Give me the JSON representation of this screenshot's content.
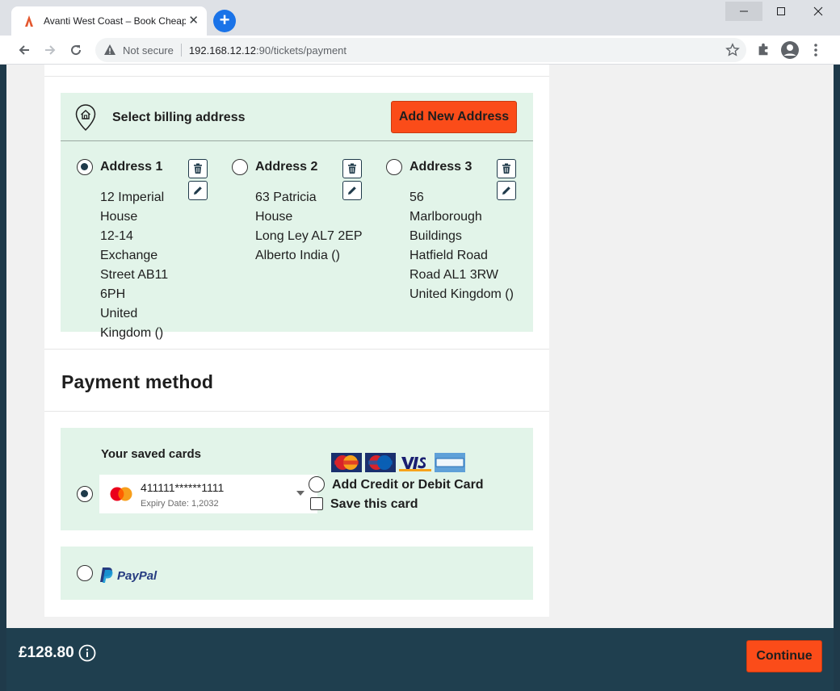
{
  "browser": {
    "tab_title": "Avanti West Coast – Book Cheap",
    "url_security": "Not secure",
    "url_host": "192.168.12.12",
    "url_path": ":90/tickets/payment",
    "accent_color": "#1a73e8"
  },
  "billing": {
    "title": "Select billing address",
    "add_button": "Add New Address",
    "addresses": [
      {
        "name": "Address 1",
        "selected": true,
        "lines": [
          "12 Imperial",
          "House",
          "12-14 Exchange",
          "Street AB11 6PH",
          "United Kingdom ()"
        ]
      },
      {
        "name": "Address 2",
        "selected": false,
        "lines": [
          "63 Patricia",
          "House",
          "Long Ley AL7 2EP",
          "Alberto India ()"
        ]
      },
      {
        "name": "Address 3",
        "selected": false,
        "lines": [
          "56",
          "Marlborough",
          "Buildings",
          "Hatfield Road",
          "Road AL1 3RW",
          "United Kingdom ()"
        ]
      }
    ]
  },
  "payment": {
    "title": "Payment method",
    "saved_cards_title": "Your saved cards",
    "saved_card": {
      "number": "411111******1111",
      "expiry": "Expiry Date: 1,2032",
      "selected": true
    },
    "card_logos": [
      "mastercard-logo",
      "maestro-logo",
      "visa-logo",
      "amex-logo"
    ],
    "add_card_label": "Add Credit or Debit Card",
    "save_card_label": "Save this card",
    "paypal_label": "PayPal"
  },
  "footer": {
    "price": "£128.80",
    "continue_button": "Continue"
  },
  "colors": {
    "brand_orange": "#fb4c19",
    "panel_green": "#e2f4e9",
    "footer_teal": "#1f3f4f"
  }
}
